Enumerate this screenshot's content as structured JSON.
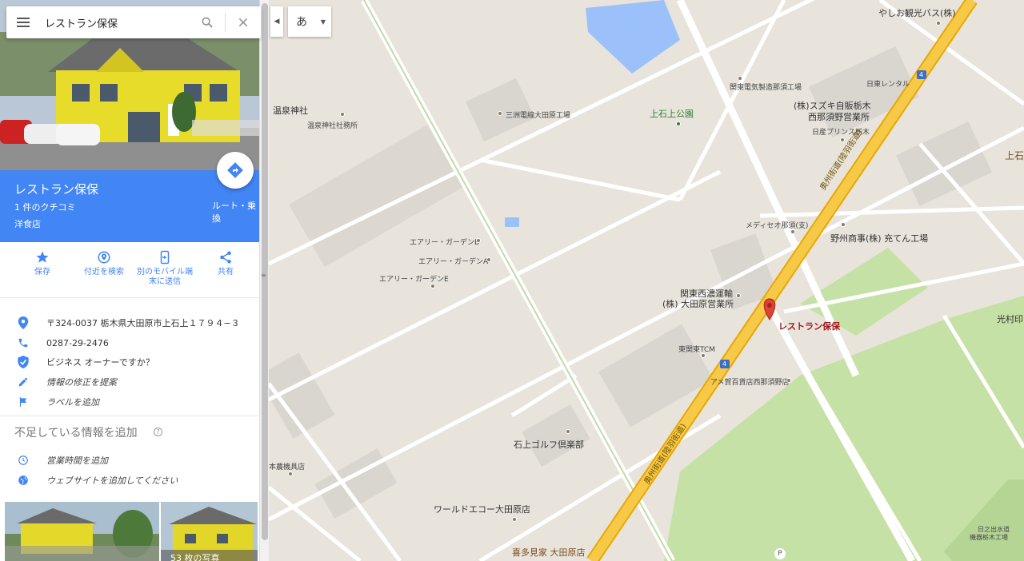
{
  "search": {
    "query": "レストラン保保"
  },
  "place": {
    "name": "レストラン保保",
    "reviews": "1 件のクチコミ",
    "category": "洋食店",
    "route_label": "ルート・乗換"
  },
  "actions": [
    {
      "label": "保存",
      "icon": "star-icon"
    },
    {
      "label": "付近を検索",
      "icon": "nearby-icon"
    },
    {
      "label_line1": "別のモバイル端",
      "label_line2": "末に送信",
      "icon": "send-to-device-icon"
    },
    {
      "label": "共有",
      "icon": "share-icon"
    }
  ],
  "info": {
    "address": "〒324-0037 栃木県大田原市上石上１７９４−３",
    "phone": "0287-29-2476",
    "owner": "ビジネス オーナーですか？",
    "suggest_edit": "情報の修正を提案",
    "add_label": "ラベルを追加"
  },
  "missing": {
    "title": "不足している情報を追加",
    "hours": "営業時間を追加",
    "website": "ウェブサイトを追加してください"
  },
  "photos": {
    "count_label": "53 枚の写真"
  },
  "map_controls": {
    "ime_char": "あ"
  },
  "map_labels": {
    "yashio": "やしお観光バス(株)",
    "kanto_denki": "関東電気製造那須工場",
    "nittou": "日東レンタル",
    "suzuki1": "(株)スズキ自販栃木",
    "suzuki2": "西那須野営業所",
    "nissan": "日産プリンス栃木",
    "kamiishi_right": "上石",
    "onsen_jinja": "温泉神社",
    "onsen_shamusho": "温泉神社社務所",
    "sanshu": "三洲電線大田原工場",
    "kamiishi_park": "上石上公園",
    "meditseo": "メディセオ那須(支)",
    "yashu": "野州商事(株) 充てん工場",
    "airy_b": "エアリー・ガーデンB",
    "airy_a": "エアリー・ガーデンA",
    "airy_e": "エアリー・ガーデンE",
    "kanto_seino1": "関東西濃運輸",
    "kanto_seino2": "(株) 大田原営業所",
    "restaurant": "レストラン保保",
    "mitsumura": "光村印",
    "tcm": "東関東TCM",
    "ame_hyakka": "アメ賀百貨店西那須野店",
    "ishigami_golf": "石上ゴルフ倶楽部",
    "noki": "本農機具店",
    "world_eco": "ワールドエコー大田原店",
    "kitakata": "喜多見家 大田原店",
    "hinode1": "日之出水道",
    "hinode2": "機器栃木工場",
    "route4_a": "4",
    "route4_b": "4",
    "oshu_kaido_1": "奥州街道(陸羽街道)",
    "oshu_kaido_2": "奥州街道(陸羽街道)",
    "parking": "P"
  },
  "colors": {
    "accent": "#4285f4",
    "map_bg": "#e8e4dc",
    "highway": "#f7c948",
    "park": "#c5e1a5",
    "pin": "#db4437"
  }
}
